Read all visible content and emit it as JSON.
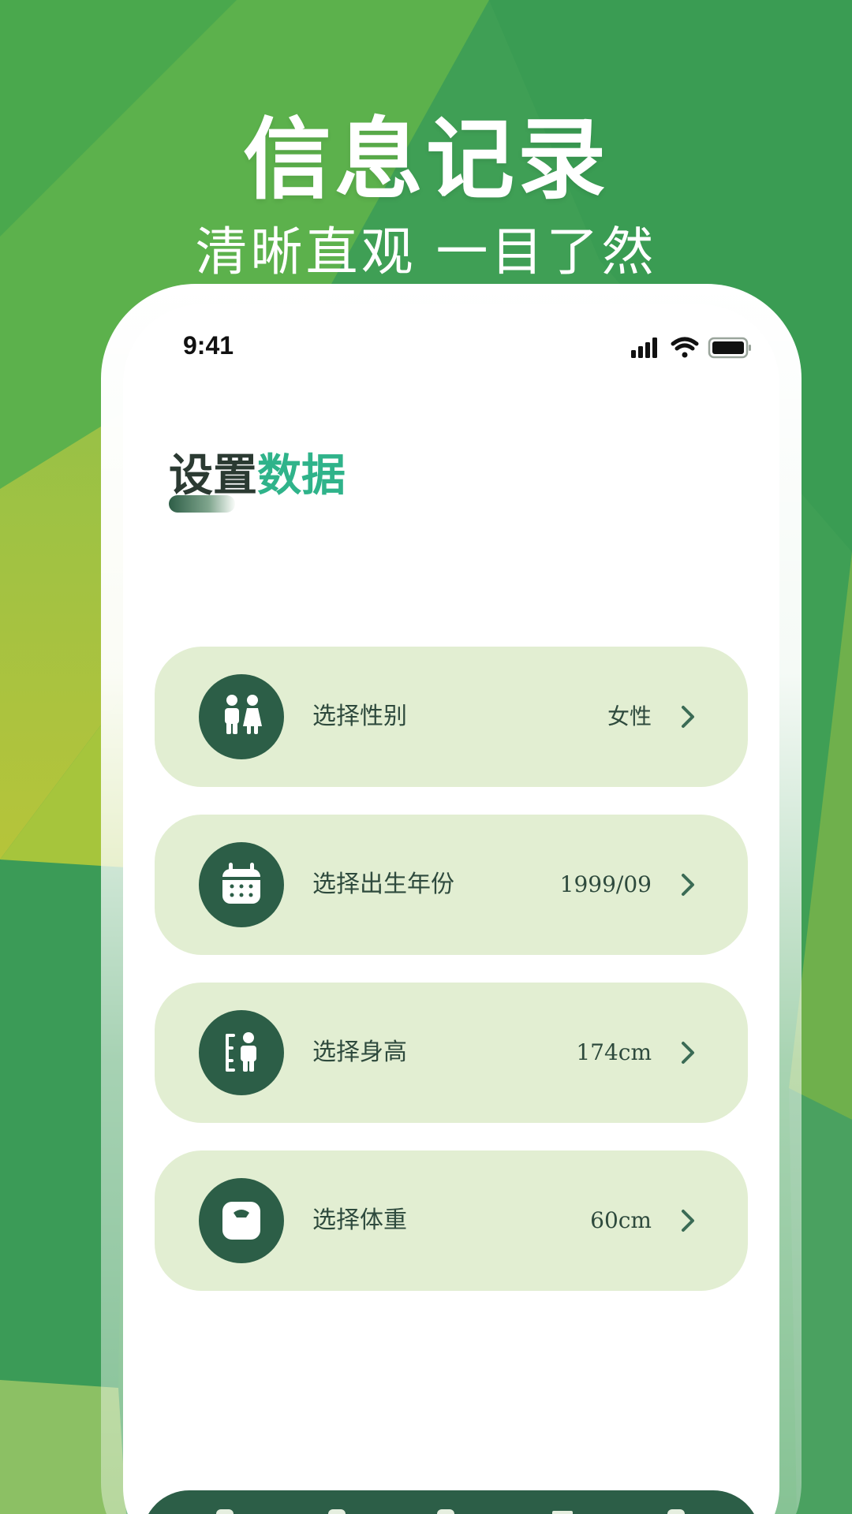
{
  "promo": {
    "title": "信息记录",
    "subtitle": "清晰直观 一目了然"
  },
  "status_bar": {
    "time": "9:41",
    "icons": [
      "signal-icon",
      "wifi-icon",
      "battery-icon"
    ]
  },
  "page": {
    "title_main": "设置",
    "title_accent": "数据"
  },
  "settings": [
    {
      "icon": "gender-icon",
      "label": "选择性别",
      "value": "女性"
    },
    {
      "icon": "calendar-icon",
      "label": "选择出生年份",
      "value": "1999/09"
    },
    {
      "icon": "height-icon",
      "label": "选择身高",
      "value": "174cm"
    },
    {
      "icon": "scale-icon",
      "label": "选择体重",
      "value": "60cm"
    }
  ],
  "colors": {
    "background_green": "#3d9f52",
    "accent_teal": "#2fb38a",
    "dark_green": "#2c5e47",
    "card_bg": "#e2eed2"
  },
  "tabbar": {
    "icons": [
      "home-icon",
      "chart-icon",
      "plus-icon",
      "record-icon",
      "profile-icon"
    ]
  }
}
